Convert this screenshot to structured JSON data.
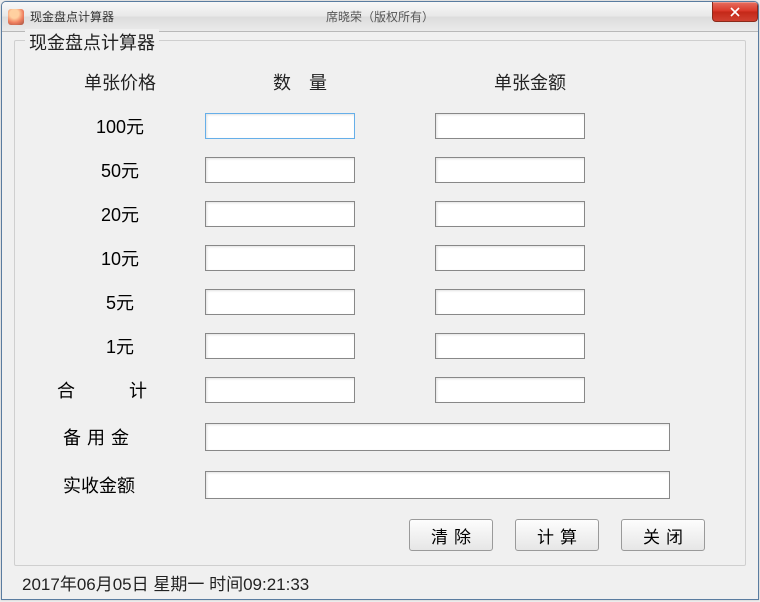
{
  "window": {
    "title": "现金盘点计算器",
    "subtitle": "席晓荣（版权所有）"
  },
  "groupbox": {
    "title": "现金盘点计算器"
  },
  "headers": {
    "price": "单张价格",
    "qty": "数　量",
    "amount": "单张金额"
  },
  "denoms": {
    "d100": "100元",
    "d50": "50元",
    "d20": "20元",
    "d10": "10元",
    "d5": "5元",
    "d1": "1元"
  },
  "labels": {
    "total": "合　计",
    "reserve": "备用金",
    "received": "实收金额"
  },
  "buttons": {
    "clear": "清除",
    "calc": "计算",
    "close": "关闭"
  },
  "values": {
    "qty100": "",
    "amt100": "",
    "qty50": "",
    "amt50": "",
    "qty20": "",
    "amt20": "",
    "qty10": "",
    "amt10": "",
    "qty5": "",
    "amt5": "",
    "qty1": "",
    "amt1": "",
    "totalQty": "",
    "totalAmt": "",
    "reserve": "",
    "received": ""
  },
  "status": {
    "text": "2017年06月05日 星期一 时间09:21:33"
  }
}
